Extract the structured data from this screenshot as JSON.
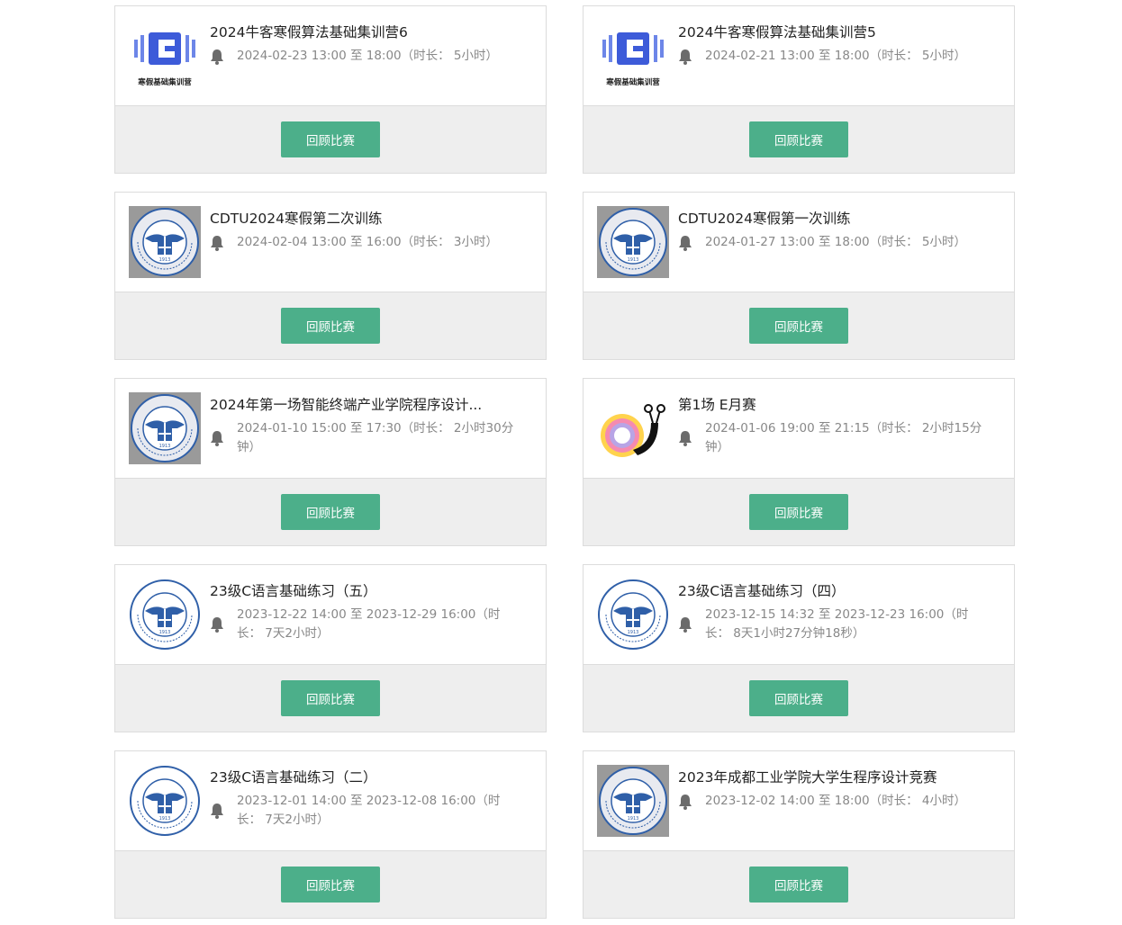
{
  "contests": [
    {
      "title": "2024牛客寒假算法基础集训营6",
      "time": "2024-02-23 13:00 至 18:00（时长： 5小时）",
      "logo": "niuke-camp",
      "logo_text": "寒假基础集训营",
      "button": "回顾比赛"
    },
    {
      "title": "2024牛客寒假算法基础集训营5",
      "time": "2024-02-21 13:00 至 18:00（时长： 5小时）",
      "logo": "niuke-camp",
      "logo_text": "寒假基础集训营",
      "button": "回顾比赛"
    },
    {
      "title": "CDTU2024寒假第二次训练",
      "time": "2024-02-04 13:00 至 16:00（时长： 3小时）",
      "logo": "university-seal-gray",
      "button": "回顾比赛"
    },
    {
      "title": "CDTU2024寒假第一次训练",
      "time": "2024-01-27 13:00 至 18:00（时长： 5小时）",
      "logo": "university-seal-gray",
      "button": "回顾比赛"
    },
    {
      "title": "2024年第一场智能终端产业学院程序设计...",
      "time": "2024-01-10 15:00 至 17:30（时长： 2小时30分钟）",
      "logo": "university-seal-gray",
      "button": "回顾比赛"
    },
    {
      "title": "第1场 E月赛",
      "time": "2024-01-06 19:00 至 21:15（时长： 2小时15分钟）",
      "logo": "snail-icon",
      "button": "回顾比赛"
    },
    {
      "title": "23级C语言基础练习（五）",
      "time": "2023-12-22 14:00 至 2023-12-29 16:00（时长： 7天2小时）",
      "logo": "university-seal-white",
      "button": "回顾比赛"
    },
    {
      "title": "23级C语言基础练习（四）",
      "time": "2023-12-15 14:32 至 2023-12-23 16:00（时长： 8天1小时27分钟18秒）",
      "logo": "university-seal-white",
      "button": "回顾比赛"
    },
    {
      "title": "23级C语言基础练习（二）",
      "time": "2023-12-01 14:00 至 2023-12-08 16:00（时长： 7天2小时）",
      "logo": "university-seal-white",
      "button": "回顾比赛"
    },
    {
      "title": "2023年成都工业学院大学生程序设计竞赛",
      "time": "2023-12-02 14:00 至 18:00（时长： 4小时）",
      "logo": "university-seal-gray",
      "button": "回顾比赛"
    }
  ],
  "colors": {
    "button": "#4caf8a",
    "card_footer": "#eeeeee",
    "border": "#dcdcdc",
    "seal_blue": "#2f5fa8",
    "camp_blue": "#3d5bd9"
  }
}
